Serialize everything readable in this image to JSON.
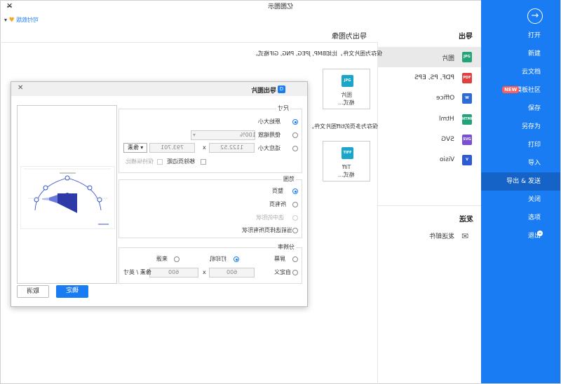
{
  "window": {
    "title": "亿图图示",
    "min_label": "─",
    "close_label": "✕"
  },
  "topbar": {
    "paid_link": "可付款版",
    "dropdown_label": "▾"
  },
  "sidebar": {
    "back_label": "→",
    "items": [
      {
        "label": "打开"
      },
      {
        "label": "新建"
      },
      {
        "label": "云文档"
      },
      {
        "label": "模板社区",
        "badge": "NEW"
      },
      {
        "label": "保存"
      },
      {
        "label": "另存为"
      },
      {
        "label": "打印"
      },
      {
        "label": "导入"
      },
      {
        "label": "导出 & 发送",
        "active": true
      },
      {
        "label": "关闭"
      },
      {
        "label": "选项"
      },
      {
        "label": "退出"
      }
    ],
    "colors": {
      "background": "#1a7cf2",
      "active": "#1563c7"
    }
  },
  "export_panel": {
    "header": "导出",
    "formats": [
      {
        "label": "图片",
        "icon": "jpg-icon",
        "icon_text": "JPG",
        "color": "#22a37a",
        "active": true
      },
      {
        "label": "PDF, PS, EPS",
        "icon": "pdf-icon",
        "icon_text": "PDF",
        "color": "#e04040"
      },
      {
        "label": "Office",
        "icon": "word-icon",
        "icon_text": "W",
        "color": "#2d6bd6"
      },
      {
        "label": "Html",
        "icon": "html-icon",
        "icon_text": "HTML",
        "color": "#22a37a"
      },
      {
        "label": "SVG",
        "icon": "svg-icon",
        "icon_text": "SVG",
        "color": "#7a4fd3"
      },
      {
        "label": "Visio",
        "icon": "visio-icon",
        "icon_text": "V",
        "color": "#2d5bd6"
      }
    ],
    "send_header": "发送",
    "send_item": "发送邮件"
  },
  "image_export": {
    "title": "导出为图像",
    "desc1": "保存为图片文件，比如BMP, JPEG, PNG, GIF格式。",
    "card1": {
      "icon_text": "JPG",
      "line1": "图片",
      "line2": "格式..."
    },
    "desc2": "保存为多页的tiff图片文件。",
    "card2": {
      "icon_text": "TIFF",
      "line1": "Tiff",
      "line2": "格式..."
    }
  },
  "dialog": {
    "title": "导出图片",
    "size_section": {
      "title": "尺寸",
      "options": [
        "原始大小",
        "使用缩放",
        "适应大小"
      ],
      "zoom_value": "100%",
      "width": "1122.52",
      "height": "793.701",
      "times": "x",
      "unit": "像素",
      "remove_margin": "移除页边距",
      "keep_ratio": "保持纵横比"
    },
    "range_section": {
      "title": "范围",
      "options": [
        "整页",
        "所有页",
        "选中的形状",
        "当前选择页所有形状"
      ]
    },
    "resolution_section": {
      "title": "分辨率",
      "options": [
        "屏幕",
        "打印机",
        "来源",
        "自定义"
      ],
      "dpi_x": "600",
      "dpi_y": "600",
      "times": "x",
      "unit": "像素 / 英寸"
    },
    "ok_label": "确定",
    "cancel_label": "取消",
    "close_label": "✕"
  }
}
